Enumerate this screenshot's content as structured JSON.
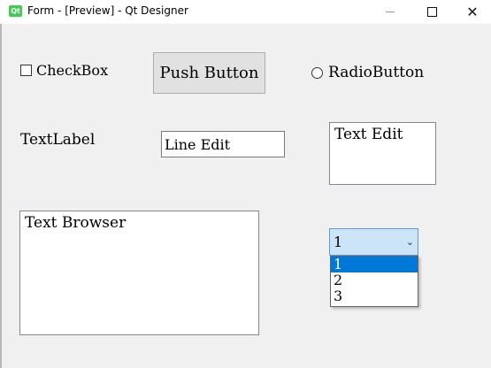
{
  "window": {
    "app_icon": "Qt",
    "title": "Form - [Preview] - Qt Designer",
    "controls": [
      "minimize-icon",
      "maximize-icon",
      "close-icon"
    ]
  },
  "form": {
    "checkbox_label": "CheckBox",
    "push_button_label": "Push Button",
    "radio_label": "RadioButton",
    "text_label": "TextLabel",
    "line_edit_value": "Line Edit",
    "text_edit_value": "Text Edit",
    "text_browser_value": "Text Browser",
    "combo": {
      "selected": "1",
      "options": [
        "1",
        "2",
        "3"
      ]
    }
  },
  "colors": {
    "selection": "#0078d7",
    "combo_focus_bg": "#cce4f7",
    "qt_green": "#41cd52"
  }
}
